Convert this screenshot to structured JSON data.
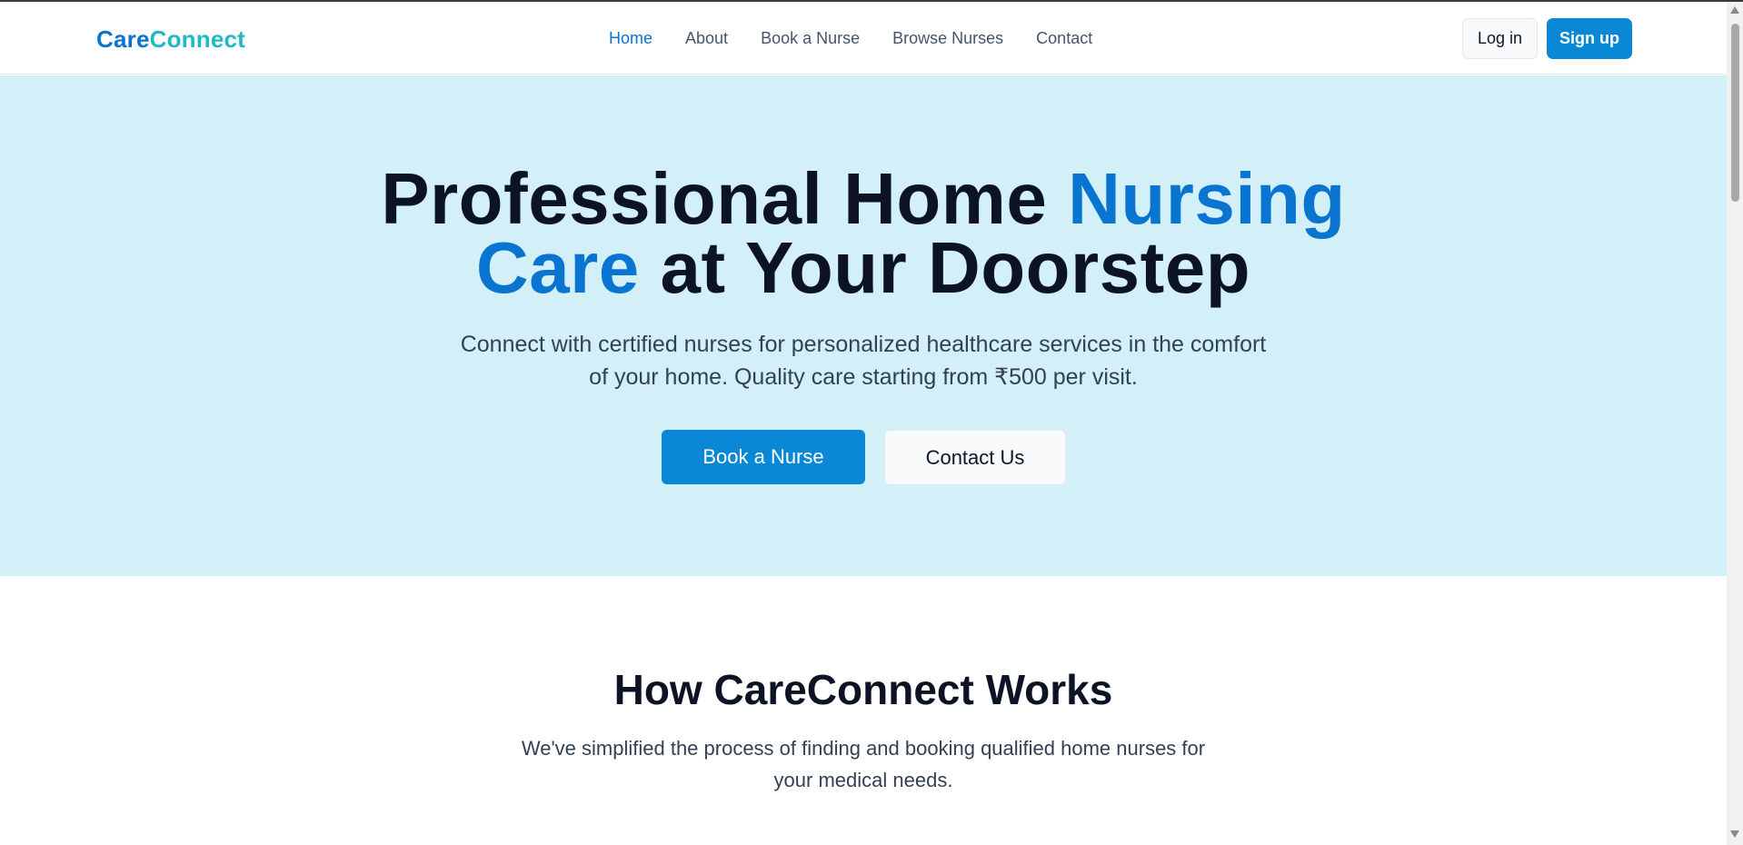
{
  "brand": {
    "part1": "Care",
    "part2": "Connect"
  },
  "nav": {
    "items": [
      {
        "label": "Home",
        "active": true
      },
      {
        "label": "About",
        "active": false
      },
      {
        "label": "Book a Nurse",
        "active": false
      },
      {
        "label": "Browse Nurses",
        "active": false
      },
      {
        "label": "Contact",
        "active": false
      }
    ],
    "login_label": "Log in",
    "signup_label": "Sign up"
  },
  "hero": {
    "title_part1": "Professional Home ",
    "title_highlight1": "Nursing",
    "title_highlight2": "Care",
    "title_part2": " at Your Doorstep",
    "subtitle_line1": "Connect with certified nurses for personalized healthcare services in the comfort",
    "subtitle_line2": "of your home. Quality care starting from ₹500 per visit.",
    "primary_button": "Book a Nurse",
    "secondary_button": "Contact Us"
  },
  "how": {
    "title": "How CareConnect Works",
    "subtitle_line1": "We've simplified the process of finding and booking qualified home nurses for",
    "subtitle_line2": "your medical needs."
  },
  "colors": {
    "primary": "#0a74d1",
    "accent": "#22b8c9",
    "button": "#0a88d6",
    "hero_bg": "#d3eff7"
  }
}
